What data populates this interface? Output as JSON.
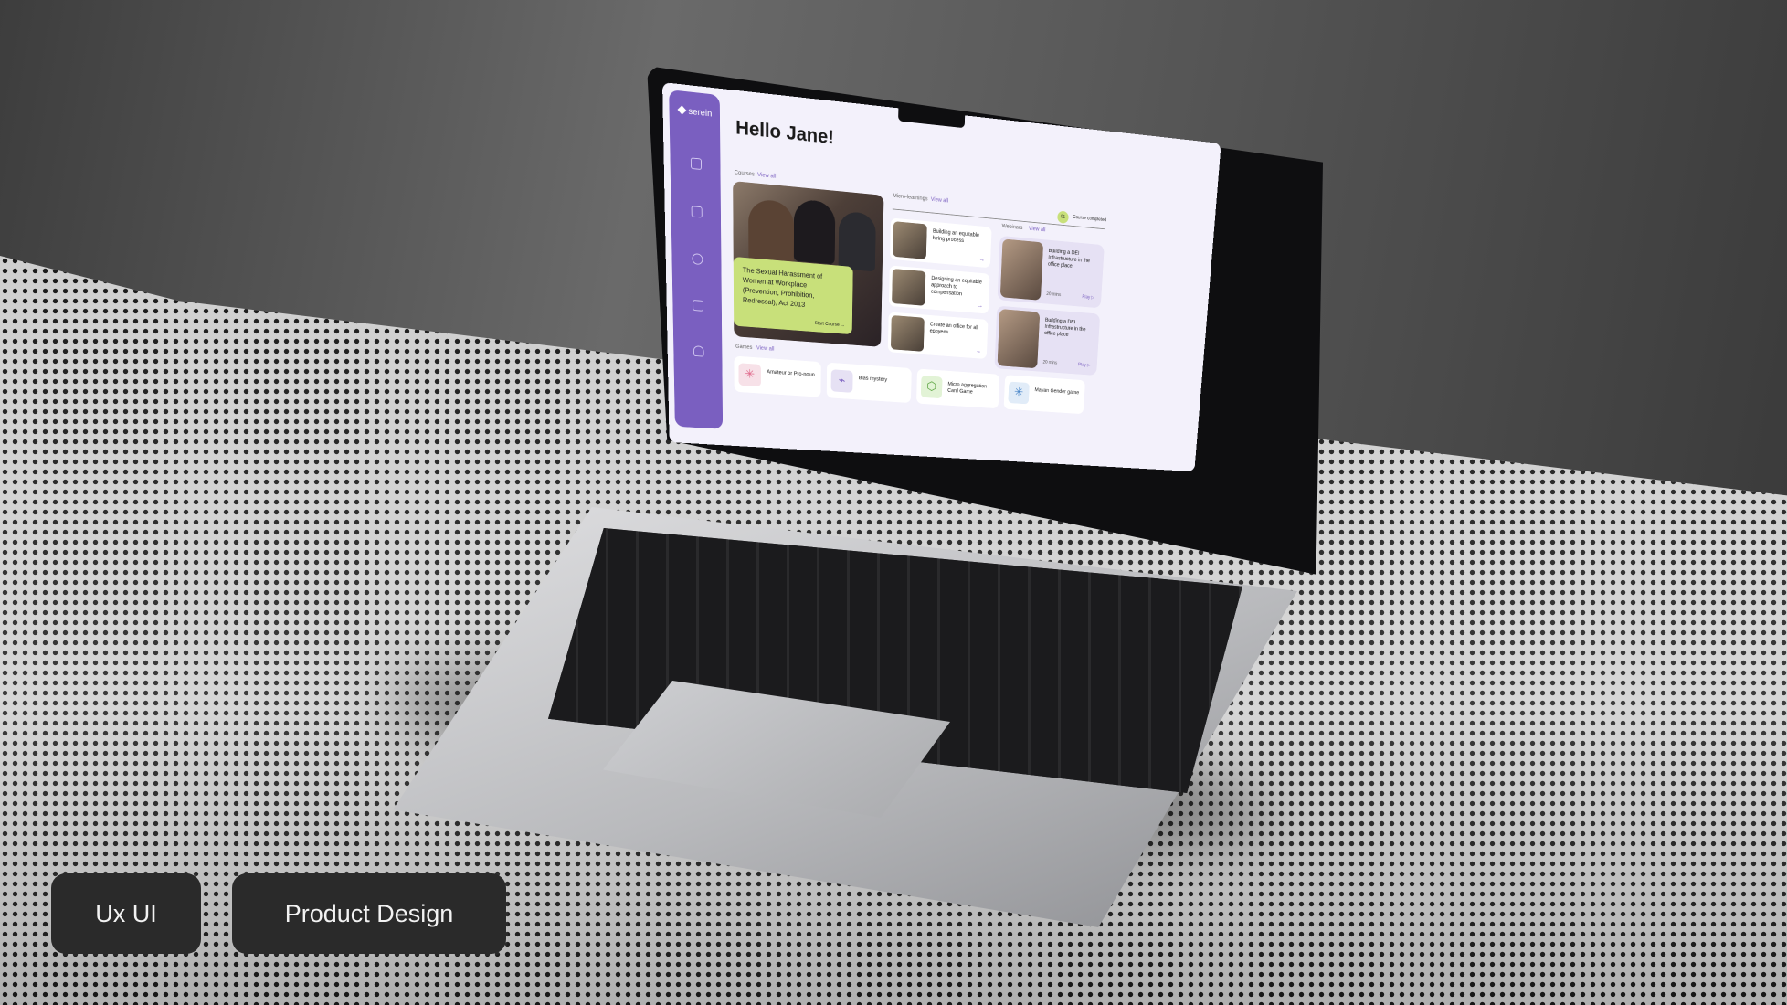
{
  "app": {
    "logo_text": "serein",
    "greeting": "Hello Jane!"
  },
  "sidebar": {
    "icons": [
      "chart-icon",
      "graduation-cap-icon",
      "circle-icon",
      "calendar-icon",
      "user-icon"
    ]
  },
  "courses": {
    "section_label": "Courses",
    "view_all": "View all",
    "featured": {
      "title": "The Sexual Harassment of Women at Workplace (Prevention, Prohibition, Redressal), Act 2013",
      "cta": "Start Course"
    }
  },
  "micro_learnings": {
    "section_label": "Micro-learnings",
    "view_all": "View all",
    "items": [
      {
        "title": "Building an equitable hiring process"
      },
      {
        "title": "Designing an equitable approach to compensation"
      },
      {
        "title": "Create an office for all epoyees"
      }
    ]
  },
  "webinars": {
    "section_label": "Webinars",
    "view_all": "View all",
    "items": [
      {
        "title": "Building a DEI Infrastructure in the office place",
        "duration": "20 mins",
        "play": "Play"
      },
      {
        "title": "Building a DEI Infrastructure in the office place",
        "duration": "20 mins",
        "play": "Play"
      }
    ]
  },
  "progress": {
    "count": "01",
    "label": "Course completed"
  },
  "games": {
    "section_label": "Games",
    "view_all": "View all",
    "items": [
      {
        "title": "Amateur or Pro-noun",
        "icon": "asterisk-icon",
        "color": "#f7e1e8"
      },
      {
        "title": "Bias mystery",
        "icon": "nodes-icon",
        "color": "#e6e1f4"
      },
      {
        "title": "Micro aggregation Card Game",
        "icon": "cube-icon",
        "color": "#e2f3d6"
      },
      {
        "title": "Mayan Gender game",
        "icon": "asterisk-icon",
        "color": "#e1ecf8"
      }
    ]
  },
  "tags": {
    "left": "Ux UI",
    "right": "Product Design"
  },
  "colors": {
    "accent": "#7a5fc0",
    "lime": "#c8e07a",
    "chip_bg": "#2a2a2a"
  }
}
